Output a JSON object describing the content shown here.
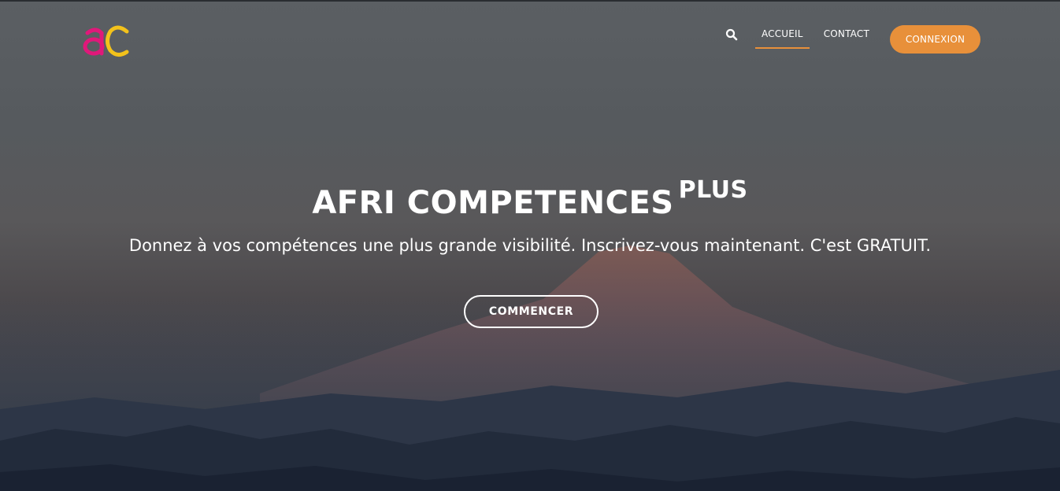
{
  "brand": {
    "logo_icon": "ac-logo-icon",
    "colors": {
      "logo_magenta": "#e0187a",
      "logo_yellow": "#f3c21b",
      "accent_orange": "#e8903a"
    }
  },
  "nav": {
    "search_icon": "search-icon",
    "items": [
      {
        "label": "ACCUEIL",
        "active": true
      },
      {
        "label": "CONTACT",
        "active": false
      }
    ],
    "login_label": "CONNEXION"
  },
  "hero": {
    "title": "AFRI COMPETENCES",
    "title_sup": "PLUS",
    "subtitle": "Donnez à vos compétences une plus grande visibilité. Inscrivez-vous maintenant. C'est GRATUIT.",
    "cta_label": "COMMENCER"
  }
}
